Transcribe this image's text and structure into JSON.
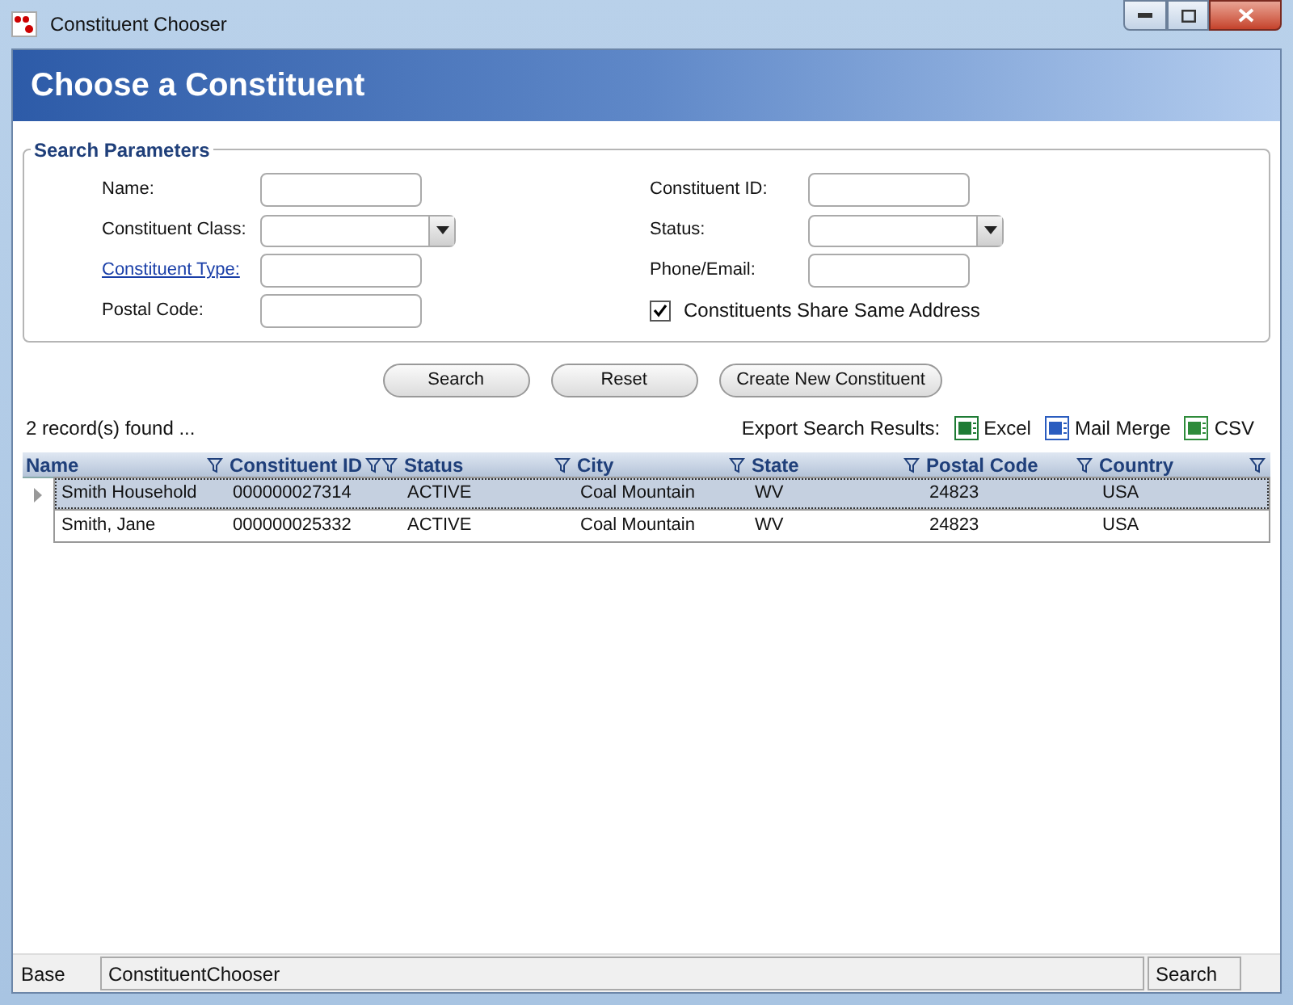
{
  "window": {
    "title": "Constituent Chooser"
  },
  "header": {
    "title": "Choose a Constituent"
  },
  "search_parameters": {
    "legend": "Search Parameters",
    "left_fields": [
      {
        "label": "Name:",
        "kind": "text",
        "link": false
      },
      {
        "label": "Constituent Class:",
        "kind": "dropdown",
        "link": false
      },
      {
        "label": "Constituent Type:",
        "kind": "text",
        "link": true
      },
      {
        "label": "Postal Code:",
        "kind": "text",
        "link": false
      }
    ],
    "right_fields": [
      {
        "label": "Constituent ID:",
        "kind": "text",
        "link": false
      },
      {
        "label": "Status:",
        "kind": "dropdown",
        "link": false
      },
      {
        "label": "Phone/Email:",
        "kind": "text",
        "link": false
      },
      {
        "label": "Constituents Share Same Address",
        "kind": "checkbox",
        "checked": true
      }
    ]
  },
  "buttons": [
    "Search",
    "Reset",
    "Create New Constituent"
  ],
  "results": {
    "count": "2 record(s) found ...",
    "export_label": "Export Search Results:",
    "exports": [
      {
        "label": "Excel",
        "kind": "excel"
      },
      {
        "label": "Mail Merge",
        "kind": "word"
      },
      {
        "label": "CSV",
        "kind": "csv"
      }
    ]
  },
  "table": {
    "columns": [
      {
        "label": "Name",
        "filtered": false
      },
      {
        "label": "Constituent ID",
        "filtered": true
      },
      {
        "label": "Status",
        "filtered": false
      },
      {
        "label": "City",
        "filtered": false
      },
      {
        "label": "State",
        "filtered": false
      },
      {
        "label": "Postal Code",
        "filtered": false
      },
      {
        "label": "Country",
        "filtered": false
      }
    ],
    "rows": [
      {
        "selected": true,
        "cells": [
          "Smith Household",
          "000000027314",
          "ACTIVE",
          "Coal Mountain",
          "WV",
          "24823",
          "USA"
        ]
      },
      {
        "selected": false,
        "cells": [
          "Smith, Jane",
          "000000025332",
          "ACTIVE",
          "Coal Mountain",
          "WV",
          "24823",
          "USA"
        ]
      }
    ]
  },
  "status_bar": {
    "left": "Base",
    "main": "ConstituentChooser",
    "right": "Search"
  }
}
